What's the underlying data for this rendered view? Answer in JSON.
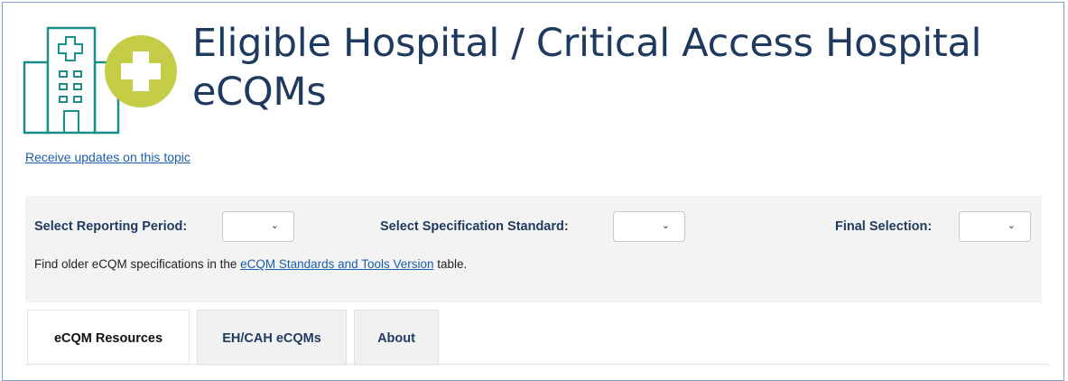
{
  "header": {
    "title_line1": "Eligible Hospital / Critical Access Hospital",
    "title_line2": "eCQMs",
    "receive_updates_link": "Receive updates on this topic"
  },
  "filters": {
    "reporting_period_label": "Select Reporting Period:",
    "reporting_period_value": "",
    "spec_standard_label": "Select Specification Standard:",
    "spec_standard_value": "",
    "final_selection_label": "Final Selection:",
    "final_selection_value": "",
    "older_prefix": "Find older eCQM specifications in the",
    "older_link": "eCQM Standards and Tools Version",
    "older_suffix": "table."
  },
  "tabs": [
    {
      "label": "eCQM Resources",
      "active": true
    },
    {
      "label": "EH/CAH eCQMs",
      "active": false
    },
    {
      "label": "About",
      "active": false
    }
  ],
  "icons": {
    "logo": "hospital-building-icon",
    "logo_badge": "plus-badge-icon",
    "dropdown": "chevron-down-icon"
  },
  "colors": {
    "title": "#1f3a5f",
    "link": "#1a5ea8",
    "logo_teal": "#1b8f8a",
    "logo_lime": "#c5cc45",
    "panel_bg": "#f3f3f3"
  }
}
